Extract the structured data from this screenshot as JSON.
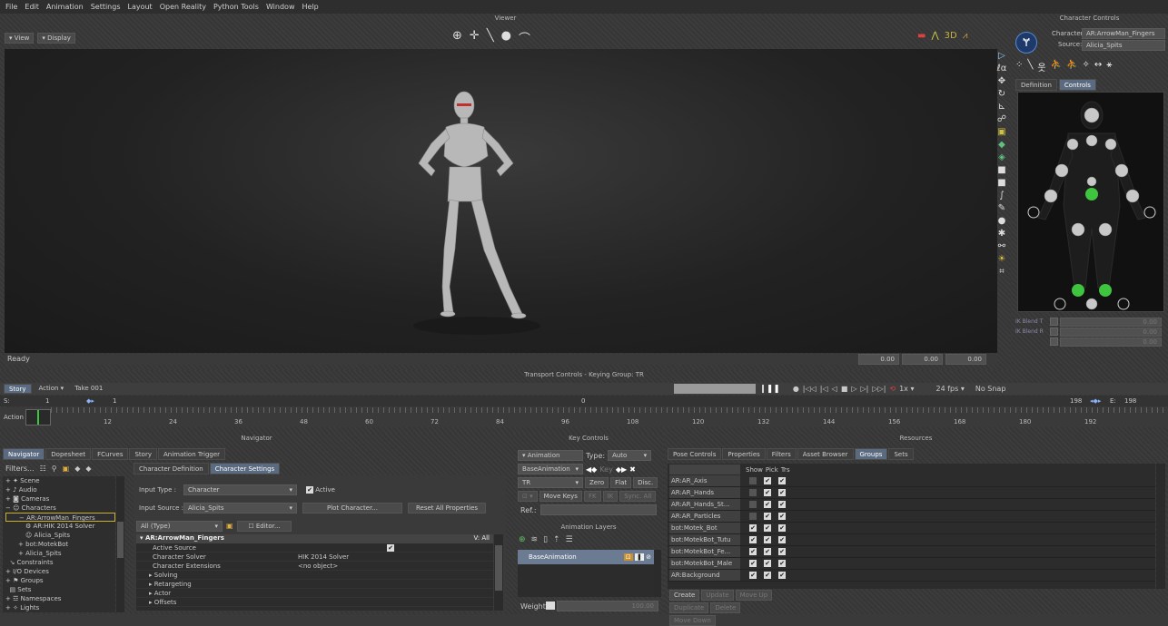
{
  "menu": [
    "File",
    "Edit",
    "Animation",
    "Settings",
    "Layout",
    "Open Reality",
    "Python Tools",
    "Window",
    "Help"
  ],
  "viewer": {
    "title": "Viewer",
    "view_label": "View",
    "display_label": "Display",
    "status": "Ready",
    "coords": [
      "0.00",
      "0.00",
      "0.00"
    ]
  },
  "character_controls": {
    "title": "Character Controls",
    "character_label": "Character:",
    "character_value": "AR:ArrowMan_Fingers",
    "source_label": "Source:",
    "source_value": "Alicia_Spits",
    "tabs": [
      "Definition",
      "Controls"
    ],
    "blend_t": "IK Blend T",
    "blend_r": "IK Blend R",
    "blend_t_val": "0.00",
    "blend_r_val": "0.00",
    "blend_x_val": "0.00"
  },
  "transport": {
    "title": "Transport Controls - Keying Group: TR",
    "story_label": "Story",
    "action_label": "Action",
    "take": "Take 001",
    "speed": "1x",
    "fps": "24 fps",
    "snap": "No Snap",
    "start_label": "S:",
    "start_val": "1",
    "frame_val": "1",
    "marker": "0",
    "end_frame": "198",
    "end_label": "E:",
    "end_val": "198",
    "action_tl": "Action",
    "ticks": [
      "12",
      "24",
      "36",
      "48",
      "60",
      "72",
      "84",
      "96",
      "108",
      "120",
      "132",
      "144",
      "156",
      "168",
      "180",
      "192"
    ]
  },
  "navigator": {
    "title": "Navigator",
    "tabs": [
      "Navigator",
      "Dopesheet",
      "FCurves",
      "Story",
      "Animation Trigger"
    ],
    "filters": "Filters...",
    "tree": [
      "Scene",
      "Audio",
      "Cameras",
      "Characters",
      "AR:ArrowMan_Fingers",
      "AR:HIK 2014 Solver",
      "Alicia_Spits",
      "bot:MotekBot",
      "Alicia_Spits",
      "Constraints",
      "I/O Devices",
      "Groups",
      "Sets",
      "Namespaces",
      "Lights"
    ],
    "subtabs": [
      "Character Definition",
      "Character Settings"
    ],
    "input_type_label": "Input Type :",
    "input_type": "Character",
    "active_label": "Active",
    "input_source_label": "Input Source :",
    "input_source": "Alicia_Spits",
    "plot_btn": "Plot Character...",
    "reset_btn": "Reset All Properties",
    "filter_type": "All (Type)",
    "editor_btn": "Editor...",
    "prop_header": "AR:ArrowMan_Fingers",
    "prop_all": "V: All",
    "props": [
      {
        "name": "Active Source",
        "value": ""
      },
      {
        "name": "Character Solver",
        "value": "HIK 2014 Solver"
      },
      {
        "name": "Character Extensions",
        "value": "<no object>"
      },
      {
        "name": "Solving",
        "value": ""
      },
      {
        "name": "Retargeting",
        "value": ""
      },
      {
        "name": "Actor",
        "value": ""
      },
      {
        "name": "Offsets",
        "value": ""
      }
    ]
  },
  "key_controls": {
    "title": "Key Controls",
    "animation_label": "Animation",
    "type_label": "Type:",
    "type_value": "Auto",
    "layer": "BaseAnimation",
    "key_label": "Key",
    "tr_value": "TR",
    "zero": "Zero",
    "flat": "Flat",
    "disc": "Disc.",
    "move_keys": "Move Keys",
    "fk": "FK",
    "ik": "IK",
    "sync": "Sync. All",
    "ref_label": "Ref.:",
    "layers_title": "Animation Layers",
    "base_layer": "BaseAnimation",
    "weight_label": "Weight",
    "weight_val": "100.00"
  },
  "resources": {
    "title": "Resources",
    "tabs": [
      "Pose Controls",
      "Properties",
      "Filters",
      "Asset Browser",
      "Groups",
      "Sets"
    ],
    "headers": [
      "Show",
      "Pick",
      "Trs"
    ],
    "groups": [
      "AR:AR_Axis",
      "AR:AR_Hands",
      "AR:AR_Hands_St...",
      "AR:AR_Particles",
      "bot:Motek_Bot",
      "bot:MotekBot_Tutu",
      "bot:MotekBot_Fe...",
      "bot:MotekBot_Male",
      "AR:Background"
    ],
    "buttons": [
      "Create",
      "Update",
      "Move Up",
      "Duplicate",
      "Delete",
      "Move Down"
    ]
  },
  "colors": {
    "accent": "#5a6a80",
    "green": "#3ec43e",
    "tab_active": "#6b7b92"
  }
}
